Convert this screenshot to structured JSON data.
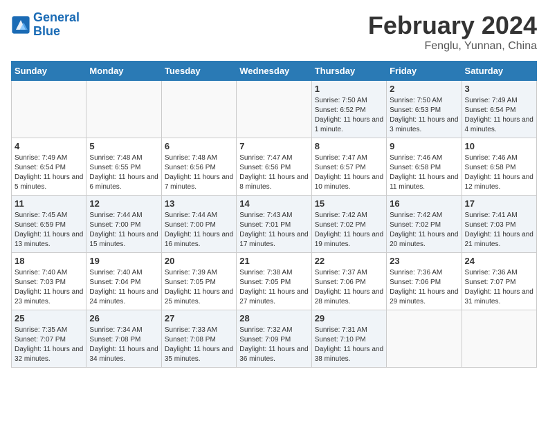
{
  "header": {
    "logo_general": "General",
    "logo_blue": "Blue",
    "month": "February 2024",
    "location": "Fenglu, Yunnan, China"
  },
  "weekdays": [
    "Sunday",
    "Monday",
    "Tuesday",
    "Wednesday",
    "Thursday",
    "Friday",
    "Saturday"
  ],
  "weeks": [
    [
      {
        "day": "",
        "info": ""
      },
      {
        "day": "",
        "info": ""
      },
      {
        "day": "",
        "info": ""
      },
      {
        "day": "",
        "info": ""
      },
      {
        "day": "1",
        "info": "Sunrise: 7:50 AM\nSunset: 6:52 PM\nDaylight: 11 hours and 1 minute."
      },
      {
        "day": "2",
        "info": "Sunrise: 7:50 AM\nSunset: 6:53 PM\nDaylight: 11 hours and 3 minutes."
      },
      {
        "day": "3",
        "info": "Sunrise: 7:49 AM\nSunset: 6:54 PM\nDaylight: 11 hours and 4 minutes."
      }
    ],
    [
      {
        "day": "4",
        "info": "Sunrise: 7:49 AM\nSunset: 6:54 PM\nDaylight: 11 hours and 5 minutes."
      },
      {
        "day": "5",
        "info": "Sunrise: 7:48 AM\nSunset: 6:55 PM\nDaylight: 11 hours and 6 minutes."
      },
      {
        "day": "6",
        "info": "Sunrise: 7:48 AM\nSunset: 6:56 PM\nDaylight: 11 hours and 7 minutes."
      },
      {
        "day": "7",
        "info": "Sunrise: 7:47 AM\nSunset: 6:56 PM\nDaylight: 11 hours and 8 minutes."
      },
      {
        "day": "8",
        "info": "Sunrise: 7:47 AM\nSunset: 6:57 PM\nDaylight: 11 hours and 10 minutes."
      },
      {
        "day": "9",
        "info": "Sunrise: 7:46 AM\nSunset: 6:58 PM\nDaylight: 11 hours and 11 minutes."
      },
      {
        "day": "10",
        "info": "Sunrise: 7:46 AM\nSunset: 6:58 PM\nDaylight: 11 hours and 12 minutes."
      }
    ],
    [
      {
        "day": "11",
        "info": "Sunrise: 7:45 AM\nSunset: 6:59 PM\nDaylight: 11 hours and 13 minutes."
      },
      {
        "day": "12",
        "info": "Sunrise: 7:44 AM\nSunset: 7:00 PM\nDaylight: 11 hours and 15 minutes."
      },
      {
        "day": "13",
        "info": "Sunrise: 7:44 AM\nSunset: 7:00 PM\nDaylight: 11 hours and 16 minutes."
      },
      {
        "day": "14",
        "info": "Sunrise: 7:43 AM\nSunset: 7:01 PM\nDaylight: 11 hours and 17 minutes."
      },
      {
        "day": "15",
        "info": "Sunrise: 7:42 AM\nSunset: 7:02 PM\nDaylight: 11 hours and 19 minutes."
      },
      {
        "day": "16",
        "info": "Sunrise: 7:42 AM\nSunset: 7:02 PM\nDaylight: 11 hours and 20 minutes."
      },
      {
        "day": "17",
        "info": "Sunrise: 7:41 AM\nSunset: 7:03 PM\nDaylight: 11 hours and 21 minutes."
      }
    ],
    [
      {
        "day": "18",
        "info": "Sunrise: 7:40 AM\nSunset: 7:03 PM\nDaylight: 11 hours and 23 minutes."
      },
      {
        "day": "19",
        "info": "Sunrise: 7:40 AM\nSunset: 7:04 PM\nDaylight: 11 hours and 24 minutes."
      },
      {
        "day": "20",
        "info": "Sunrise: 7:39 AM\nSunset: 7:05 PM\nDaylight: 11 hours and 25 minutes."
      },
      {
        "day": "21",
        "info": "Sunrise: 7:38 AM\nSunset: 7:05 PM\nDaylight: 11 hours and 27 minutes."
      },
      {
        "day": "22",
        "info": "Sunrise: 7:37 AM\nSunset: 7:06 PM\nDaylight: 11 hours and 28 minutes."
      },
      {
        "day": "23",
        "info": "Sunrise: 7:36 AM\nSunset: 7:06 PM\nDaylight: 11 hours and 29 minutes."
      },
      {
        "day": "24",
        "info": "Sunrise: 7:36 AM\nSunset: 7:07 PM\nDaylight: 11 hours and 31 minutes."
      }
    ],
    [
      {
        "day": "25",
        "info": "Sunrise: 7:35 AM\nSunset: 7:07 PM\nDaylight: 11 hours and 32 minutes."
      },
      {
        "day": "26",
        "info": "Sunrise: 7:34 AM\nSunset: 7:08 PM\nDaylight: 11 hours and 34 minutes."
      },
      {
        "day": "27",
        "info": "Sunrise: 7:33 AM\nSunset: 7:08 PM\nDaylight: 11 hours and 35 minutes."
      },
      {
        "day": "28",
        "info": "Sunrise: 7:32 AM\nSunset: 7:09 PM\nDaylight: 11 hours and 36 minutes."
      },
      {
        "day": "29",
        "info": "Sunrise: 7:31 AM\nSunset: 7:10 PM\nDaylight: 11 hours and 38 minutes."
      },
      {
        "day": "",
        "info": ""
      },
      {
        "day": "",
        "info": ""
      }
    ]
  ]
}
